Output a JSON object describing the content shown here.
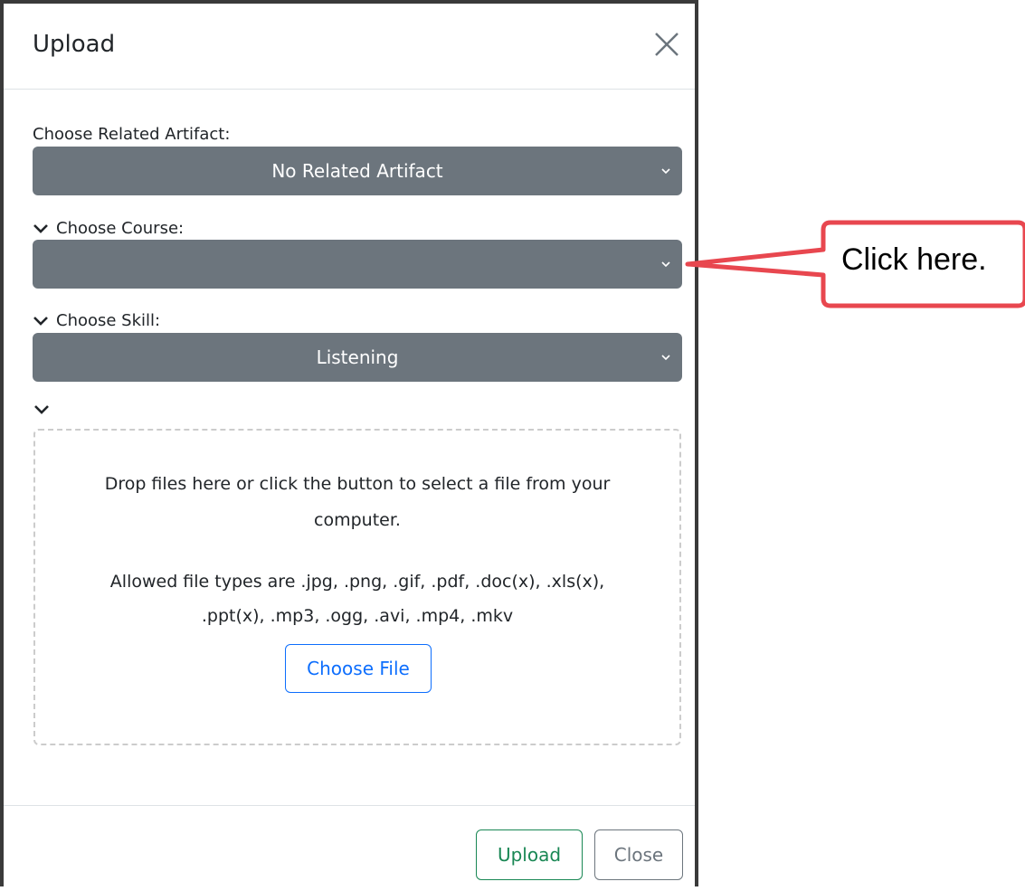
{
  "modal": {
    "title": "Upload",
    "close_icon": "close-icon"
  },
  "fields": {
    "related_artifact": {
      "label": "Choose Related Artifact:",
      "value": "No Related Artifact"
    },
    "course": {
      "label": "Choose Course:",
      "value": ""
    },
    "skill": {
      "label": "Choose Skill:",
      "value": "Listening"
    }
  },
  "dropzone": {
    "line1": "Drop files here or click the button to select a file from your",
    "line2": "computer.",
    "line3": "Allowed file types are .jpg, .png, .gif, .pdf, .doc(x), .xls(x),",
    "line4": ".ppt(x), .mp3, .ogg, .avi, .mp4, .mkv",
    "choose_button": "Choose File"
  },
  "footer": {
    "upload_button": "Upload",
    "close_button": "Close"
  },
  "callout": {
    "text": "Click here."
  },
  "colors": {
    "select_bg": "#6c757d",
    "primary": "#0d6efd",
    "success": "#198754",
    "callout_border": "#e8474f"
  }
}
